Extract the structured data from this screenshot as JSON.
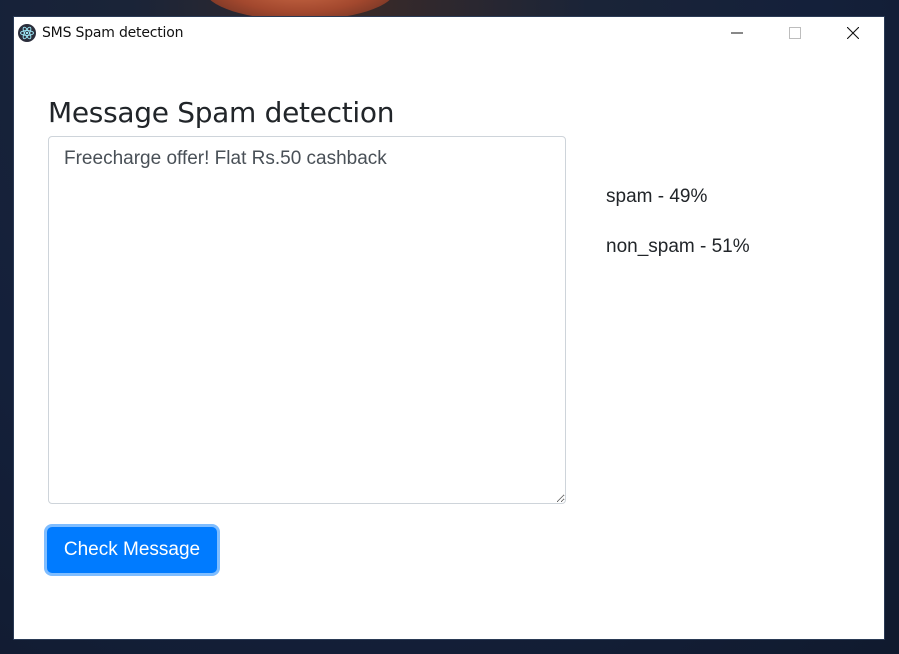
{
  "window": {
    "title": "SMS Spam detection",
    "app_icon": "electron-atom-icon",
    "controls": {
      "minimize_icon": "minimize-icon",
      "maximize_icon": "maximize-icon",
      "close_icon": "close-icon"
    }
  },
  "main": {
    "heading": "Message Spam detection",
    "message_value": "Freecharge offer! Flat Rs.50 cashback",
    "check_button_label": "Check Message",
    "results": {
      "spam": "spam - 49%",
      "non_spam": "non_spam - 51%"
    }
  },
  "colors": {
    "accent": "#007bff",
    "accent_focus_ring": "#7fbdff",
    "heading_text": "#212529",
    "input_border": "#ced4da"
  }
}
